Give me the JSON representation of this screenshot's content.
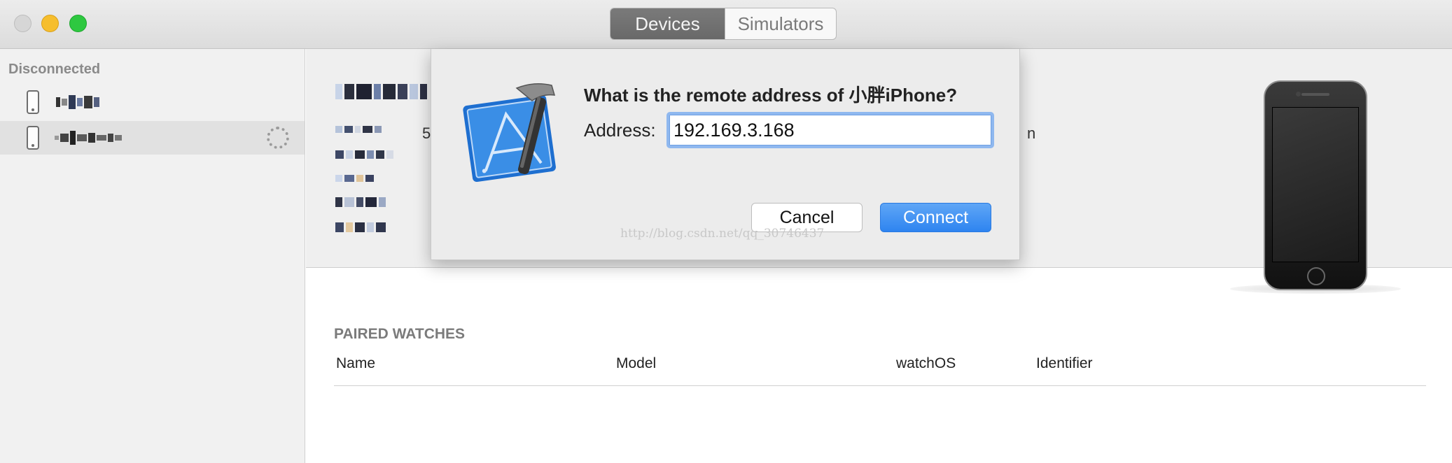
{
  "window": {
    "tabs": [
      {
        "label": "Devices",
        "selected": true
      },
      {
        "label": "Simulators",
        "selected": false
      }
    ]
  },
  "sidebar": {
    "section_header": "Disconnected",
    "devices": [
      {
        "icon": "iphone-icon",
        "name_redacted": true
      },
      {
        "icon": "iphone-icon",
        "name_redacted": true,
        "selected": true,
        "status_icon": "spinner-icon"
      }
    ]
  },
  "device_detail": {
    "stray_glyphs": [
      "5",
      "n"
    ]
  },
  "paired_watches": {
    "title": "PAIRED WATCHES",
    "columns": [
      "Name",
      "Model",
      "watchOS",
      "Identifier"
    ]
  },
  "dialog": {
    "title": "What is the remote address of 小胖iPhone?",
    "address_label": "Address:",
    "address_value": "192.169.3.168",
    "cancel_label": "Cancel",
    "connect_label": "Connect",
    "watermark": "http://blog.csdn.net/qq_30746437",
    "accent_color": "#2e84f0"
  }
}
